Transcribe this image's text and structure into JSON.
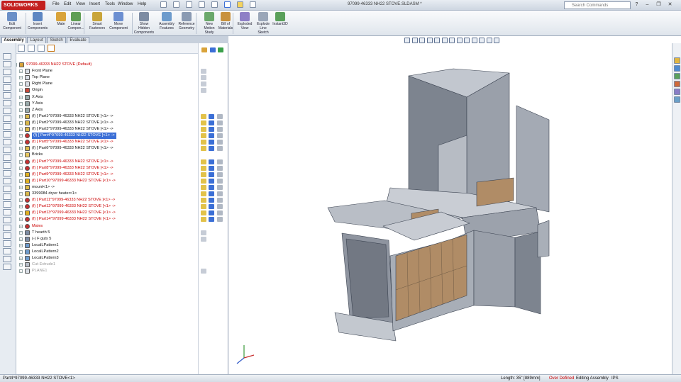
{
  "app": {
    "logo": "SOLIDWORKS",
    "menus": [
      "File",
      "Edit",
      "View",
      "Insert",
      "Tools",
      "Window",
      "Help"
    ],
    "doc_title": "97099-46333 NH22 STOVE.SLDASM *",
    "search_placeholder": "Search Commands"
  },
  "ribbon": {
    "buttons": [
      {
        "label": "Edit\nComponent",
        "icon": "edit-component-icon"
      },
      {
        "label": "Insert\nComponents",
        "icon": "insert-components-icon"
      },
      {
        "label": "Mate",
        "icon": "mate-icon"
      },
      {
        "label": "Linear\nCompon...",
        "icon": "linear-pattern-icon"
      },
      {
        "label": "Smart\nFasteners",
        "icon": "smart-fasteners-icon"
      },
      {
        "label": "Move\nComponent",
        "icon": "move-component-icon"
      },
      {
        "label": "Show\nHidden\nComponents",
        "icon": "show-hidden-icon"
      },
      {
        "label": "Assembly\nFeatures",
        "icon": "assembly-features-icon"
      },
      {
        "label": "Reference\nGeometry",
        "icon": "reference-geometry-icon"
      },
      {
        "label": "New\nMotion\nStudy",
        "icon": "motion-study-icon"
      },
      {
        "label": "Bill of\nMaterials",
        "icon": "bom-icon"
      },
      {
        "label": "Exploded\nView",
        "icon": "exploded-view-icon"
      },
      {
        "label": "Explode\nLine\nSketch",
        "icon": "explode-line-icon"
      },
      {
        "label": "Instant3D",
        "icon": "instant3d-icon"
      }
    ]
  },
  "tabs": [
    "Assembly",
    "Layout",
    "Sketch",
    "Evaluate"
  ],
  "tree": {
    "rows": [
      {
        "text": "97099-46333 NH22 STOVE  (Default)",
        "indent": 0,
        "icon": "assembly-icon",
        "cls": "red"
      },
      {
        "text": "Front Plane",
        "indent": 1,
        "icon": "plane-icon"
      },
      {
        "text": "Top Plane",
        "indent": 1,
        "icon": "plane-icon"
      },
      {
        "text": "Right Plane",
        "indent": 1,
        "icon": "plane-icon"
      },
      {
        "text": "Origin",
        "indent": 1,
        "icon": "origin-icon"
      },
      {
        "text": "X Axis",
        "indent": 1,
        "icon": "axis-icon"
      },
      {
        "text": "Y Axis",
        "indent": 1,
        "icon": "axis-icon"
      },
      {
        "text": "Z Axis",
        "indent": 1,
        "icon": "axis-icon"
      },
      {
        "text": "(f) [ Part1^97099-46333 NH22 STOVE ]<1> ->",
        "indent": 1,
        "icon": "part-icon"
      },
      {
        "text": "(f) [ Part2^97099-46333 NH22 STOVE ]<1> ->",
        "indent": 1,
        "icon": "part-icon"
      },
      {
        "text": "(f) [ Part3^97099-46333 NH22 STOVE ]<1> ->",
        "indent": 1,
        "icon": "part-icon"
      },
      {
        "text": "(f) [ Part4^97099-46333 NH22 STOVE ]<1> ->",
        "indent": 1,
        "icon": "part-error-icon",
        "sel": true
      },
      {
        "text": "(f) [ Part5^97099-46333 NH22 STOVE ]<1> ->",
        "indent": 1,
        "icon": "part-error-icon",
        "cls": "red"
      },
      {
        "text": "(f) [ Part6^97099-46333 NH22 STOVE ]<1> ->",
        "indent": 1,
        "icon": "part-icon"
      },
      {
        "text": "Bricks",
        "indent": 1,
        "icon": "folder-icon"
      },
      {
        "text": "(f) [ Part7^97099-46333 NH22 STOVE ]<1> ->",
        "indent": 1,
        "icon": "part-error-icon",
        "cls": "red"
      },
      {
        "text": "(f) [ Part8^97099-46333 NH22 STOVE ]<1> ->",
        "indent": 1,
        "icon": "part-error-icon",
        "cls": "red"
      },
      {
        "text": "(f) [ Part9^97099-46333 NH22 STOVE ]<1> ->",
        "indent": 1,
        "icon": "part-warning-icon",
        "cls": "red"
      },
      {
        "text": "(f) [ Part10^97099-46333 NH22 STOVE ]<1> ->",
        "indent": 1,
        "icon": "part-warning-icon",
        "cls": "red"
      },
      {
        "text": "mount<1> ->",
        "indent": 1,
        "icon": "part-icon"
      },
      {
        "text": "3399084 dryer heater<1>",
        "indent": 1,
        "icon": "part-icon"
      },
      {
        "text": "(f) [ Part11^97099-46333 NH22 STOVE ]<1> ->",
        "indent": 1,
        "icon": "part-error-icon",
        "cls": "red"
      },
      {
        "text": "(f) [ Part12^97099-46333 NH22 STOVE ]<1> ->",
        "indent": 1,
        "icon": "part-error-icon",
        "cls": "red"
      },
      {
        "text": "(f) [ Part13^97099-46333 NH22 STOVE ]<1> ->",
        "indent": 1,
        "icon": "part-warning-icon",
        "cls": "red"
      },
      {
        "text": "(f) [ Part14^97099-46333 NH22 STOVE ]<1> ->",
        "indent": 1,
        "icon": "part-error-icon",
        "cls": "red"
      },
      {
        "text": "Mates",
        "indent": 1,
        "icon": "mates-error-icon",
        "cls": "red"
      },
      {
        "text": "T hearth 5",
        "indent": 1,
        "icon": "mate-icon"
      },
      {
        "text": "(-) F guts 5",
        "indent": 1,
        "icon": "mate-icon"
      },
      {
        "text": "LocalLPattern1",
        "indent": 1,
        "icon": "pattern-icon"
      },
      {
        "text": "LocalLPattern2",
        "indent": 1,
        "icon": "pattern-icon"
      },
      {
        "text": "LocalLPattern3",
        "indent": 1,
        "icon": "pattern-icon"
      },
      {
        "text": "Cut-Extrude1",
        "indent": 1,
        "icon": "cut-icon",
        "dim": true
      },
      {
        "text": "PLANE1",
        "indent": 1,
        "icon": "plane-icon",
        "dim": true
      }
    ]
  },
  "status": {
    "left": "Part4^97099-46333 NH22 STOVE<1>",
    "length": "Length: 35\" [889mm]",
    "defined": "Over Defined",
    "mode": "Editing Assembly",
    "units": "IPS"
  },
  "colors": {
    "accent": "#3b6fd6",
    "error": "#cc0000",
    "sheetmetal": "#8e949f",
    "brick": "#b08c66"
  }
}
